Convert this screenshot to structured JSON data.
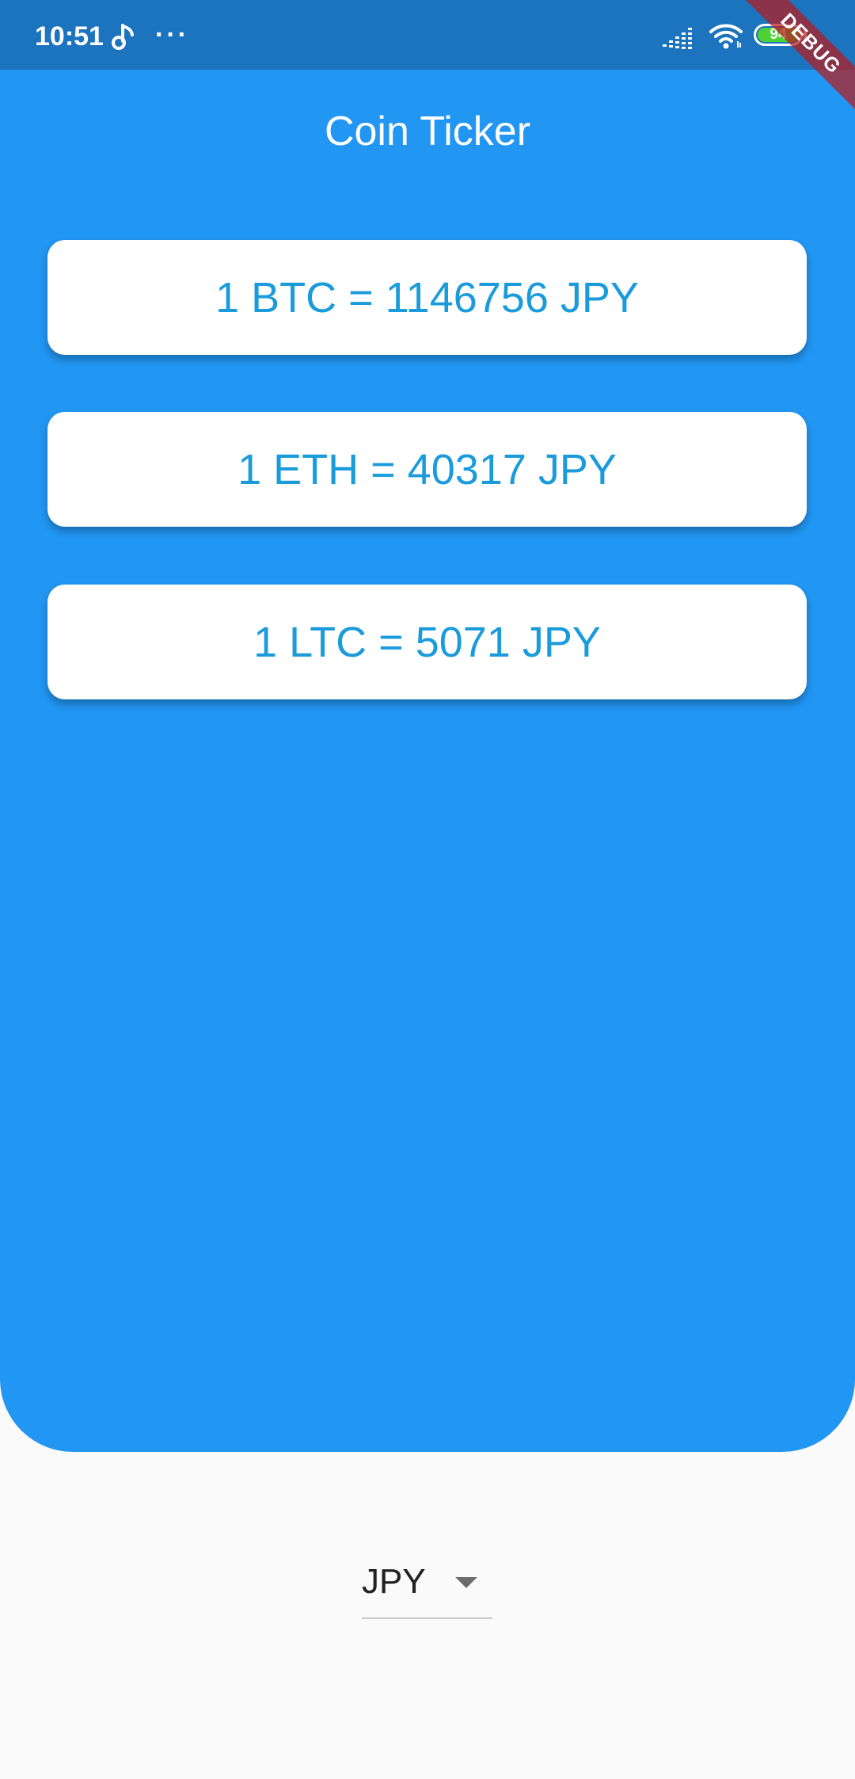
{
  "status_bar": {
    "time": "10:51",
    "more_indicator": "···",
    "battery_level": "94",
    "icons": [
      "music-note-icon",
      "more-dots-icon",
      "signal-icon",
      "wifi-icon",
      "battery-icon"
    ]
  },
  "debug_banner": {
    "label": "DEBUG"
  },
  "app_bar": {
    "title": "Coin Ticker"
  },
  "rates": [
    {
      "label": "1 BTC = 1146756 JPY"
    },
    {
      "label": "1 ETH = 40317 JPY"
    },
    {
      "label": "1 LTC = 5071 JPY"
    }
  ],
  "currency_dropdown": {
    "selected": "JPY",
    "icon": "dropdown-arrow-icon"
  },
  "colors": {
    "primary": "#2196f3",
    "status_bar": "#1c74bf",
    "rate_text": "#1a9bdc",
    "background": "#fafafa",
    "battery": "#4cd137"
  }
}
